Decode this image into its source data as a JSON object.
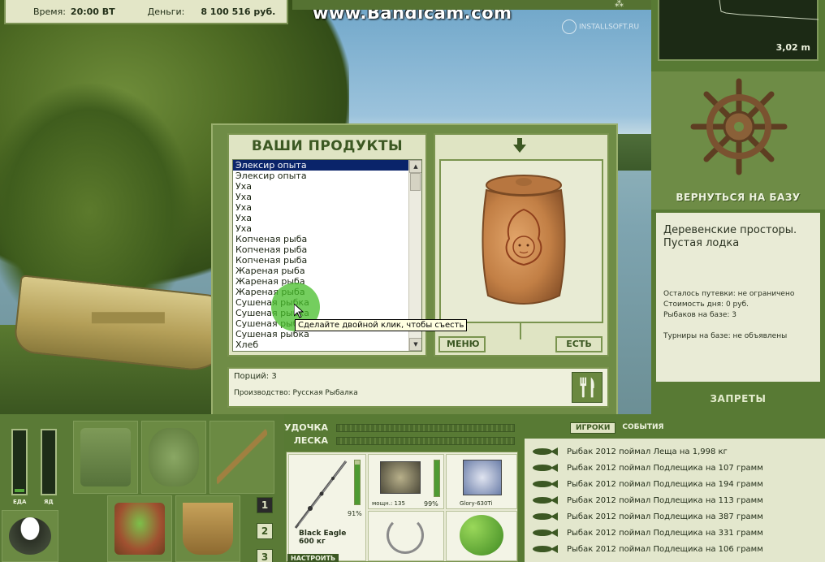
{
  "watermark": "www.Bandicam.com",
  "watermark_secondary": "INSTALLSOFT.RU",
  "status_bar": {
    "time_label": "Время:",
    "time_value": "20:00 ВТ",
    "money_label": "Деньги:",
    "money_value": "8 100 516 руб."
  },
  "depth": {
    "value": "3,02 m"
  },
  "right_panel": {
    "return_label": "ВЕРНУТЬСЯ НА БАЗУ",
    "location_title": "Деревенские просторы. Пустая лодка",
    "info_lines": [
      "Осталось путевки: не ограничено",
      "Стоимость дня: 0 руб.",
      "Рыбаков на базе: 3",
      "Турниры на базе: не объявлены"
    ],
    "bans_label": "ЗАПРЕТЫ"
  },
  "modal": {
    "title": "ВАШИ ПРОДУКТЫ",
    "items": [
      "Элексир опыта",
      "Элексир опыта",
      "Уха",
      "Уха",
      "Уха",
      "Уха",
      "Уха",
      "Копченая рыба",
      "Копченая рыба",
      "Копченая рыба",
      "Жареная рыба",
      "Жареная рыба",
      "Жареная рыба",
      "Сушеная рыбка",
      "Сушеная рыбка",
      "Сушеная рыбка",
      "Сушеная рыбка",
      "Хлеб"
    ],
    "selected_index": 0,
    "menu_button": "МЕНЮ",
    "eat_button": "ЕСТЬ",
    "portions": "Порций: 3",
    "production": "Производство: Русская Рыбалка",
    "tooltip": "Сделайте двойной клик, чтобы съесть"
  },
  "meters": {
    "food_label": "ЕДА",
    "food_level": 0.05,
    "yad_label": "ЯД",
    "yad_level": 0
  },
  "pages": [
    "1",
    "2",
    "3"
  ],
  "tension": {
    "rod_label": "УДОЧКА",
    "line_label": "ЛЕСКА"
  },
  "gear": {
    "rod_name": "Black Eagle",
    "rod_weight": "600 кг",
    "rod_pct": "91%",
    "reel_label": "мощн.: 135",
    "reel_pct": "99%",
    "line_label": "Glory-630Ti",
    "setup_button": "НАСТРОИТЬ"
  },
  "events": {
    "tab_players": "ИГРОКИ",
    "tab_events": "СОБЫТИЯ",
    "rows": [
      "Рыбак 2012 поймал Леща на 1,998 кг",
      "Рыбак 2012 поймал Подлещика на 107 грамм",
      "Рыбак 2012 поймал Подлещика на 194 грамм",
      "Рыбак 2012 поймал Подлещика на 113 грамм",
      "Рыбак 2012 поймал Подлещика на 387 грамм",
      "Рыбак 2012 поймал Подлещика на 331 грамм",
      "Рыбак 2012 поймал Подлещика на 106 грамм"
    ]
  },
  "colors": {
    "panel_green": "#587a34",
    "panel_light": "#dfe4c3",
    "title_green": "#3c5823",
    "selection": "#0a246a",
    "cursor_highlight": "#46be28"
  }
}
